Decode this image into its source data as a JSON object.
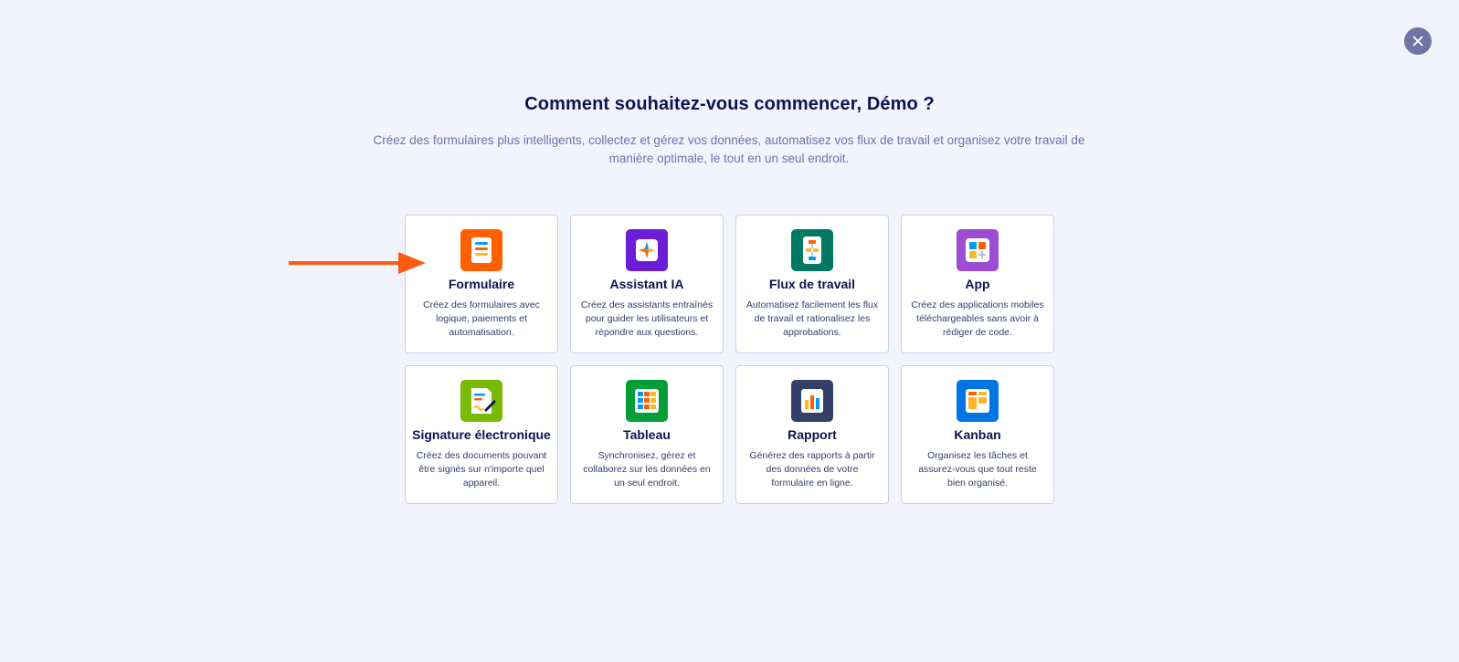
{
  "header": {
    "title": "Comment souhaitez-vous commencer, Démo ?",
    "subtitle": "Créez des formulaires plus intelligents, collectez et gérez vos données, automatisez vos flux de travail et organisez votre travail de manière optimale, le tout en un seul endroit."
  },
  "close": {
    "icon": "close-icon"
  },
  "cards": [
    {
      "title": "Formulaire",
      "description": "Créez des formulaires avec logique, paiements et automatisation.",
      "icon": "form-icon",
      "color": "#ff6100"
    },
    {
      "title": "Assistant IA",
      "description": "Créez des assistants entraînés pour guider les utilisateurs et répondre aux questions.",
      "icon": "ai-agent-icon",
      "color": "#6c1ed6"
    },
    {
      "title": "Flux de travail",
      "description": "Automatisez facilement les flux de travail et rationalisez les approbations.",
      "icon": "workflow-icon",
      "color": "#007862"
    },
    {
      "title": "App",
      "description": "Créez des applications mobiles téléchargeables sans avoir à rédiger de code.",
      "icon": "app-icon",
      "color": "#9c4dd3"
    },
    {
      "title": "Signature électronique",
      "description": "Créez des documents pouvant être signés sur n'importe quel appareil.",
      "icon": "sign-icon",
      "color": "#78bb07"
    },
    {
      "title": "Tableau",
      "description": "Synchronisez, gérez et collaborez sur les données en un seul endroit.",
      "icon": "table-icon",
      "color": "#049e38"
    },
    {
      "title": "Rapport",
      "description": "Générez des rapports à partir des données de votre formulaire en ligne.",
      "icon": "report-icon",
      "color": "#344067"
    },
    {
      "title": "Kanban",
      "description": "Organisez les tâches et assurez-vous que tout reste bien organisé.",
      "icon": "kanban-icon",
      "color": "#0075e3"
    }
  ],
  "annotation": {
    "arrow_color": "#ff5a14"
  }
}
